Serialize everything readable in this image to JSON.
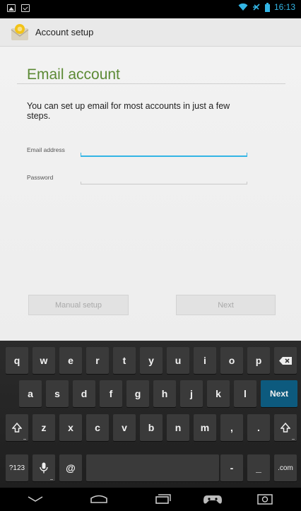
{
  "status_bar": {
    "time": "16:13",
    "accent_color": "#33b5e5"
  },
  "action_bar": {
    "title": "Account setup",
    "app_icon": "email-app-icon"
  },
  "form": {
    "heading": "Email account",
    "intro": "You can set up email for most accounts in just a few steps.",
    "email_label": "Email address",
    "email_value": "",
    "password_label": "Password",
    "password_value": ""
  },
  "buttons": {
    "manual_setup": "Manual setup",
    "next": "Next"
  },
  "keyboard": {
    "row1": [
      "q",
      "w",
      "e",
      "r",
      "t",
      "y",
      "u",
      "i",
      "o",
      "p"
    ],
    "row2": [
      "a",
      "s",
      "d",
      "f",
      "g",
      "h",
      "j",
      "k",
      "l"
    ],
    "row3": [
      "z",
      "x",
      "c",
      "v",
      "b",
      "n",
      "m",
      ",",
      "."
    ],
    "row4": {
      "symbols": "?123",
      "at": "@",
      "dash": "-",
      "underscore": "_",
      "com": ".com"
    },
    "next_label": "Next",
    "next_color": "#0d5a7e"
  },
  "colors": {
    "heading": "#5c8a35",
    "focus_underline": "#33b5e5"
  }
}
